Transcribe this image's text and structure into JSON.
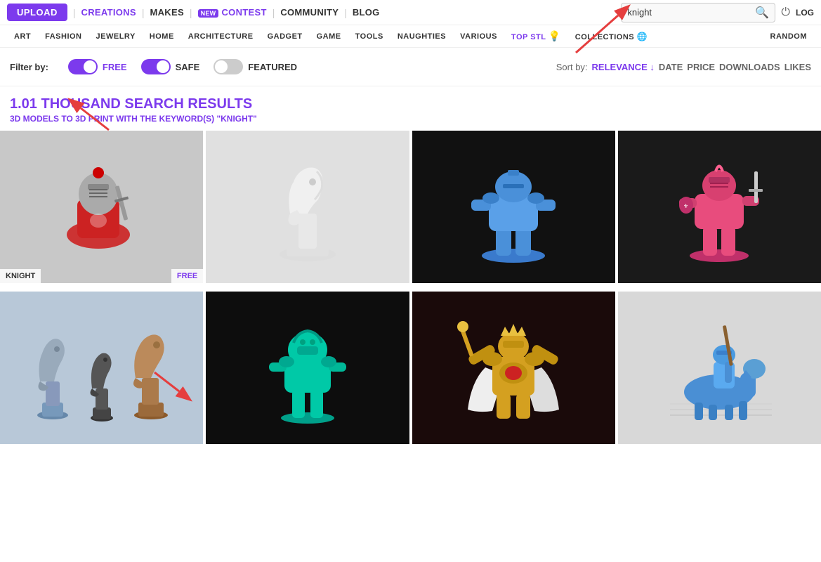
{
  "topnav": {
    "upload_label": "UPLOAD",
    "creations_label": "CREATIONS",
    "makes_label": "MAKES",
    "new_badge": "NEW",
    "contest_label": "CONTEST",
    "community_label": "COMMUNITY",
    "blog_label": "BLOG",
    "search_value": "knight",
    "log_label": "LOG"
  },
  "secondnav": {
    "categories": [
      {
        "label": "ART",
        "active": false
      },
      {
        "label": "FASHION",
        "active": false
      },
      {
        "label": "JEWELRY",
        "active": false
      },
      {
        "label": "HOME",
        "active": false
      },
      {
        "label": "ARCHITECTURE",
        "active": false
      },
      {
        "label": "GADGET",
        "active": false
      },
      {
        "label": "GAME",
        "active": false
      },
      {
        "label": "TOOLS",
        "active": false
      },
      {
        "label": "NAUGHTIES",
        "active": false
      },
      {
        "label": "VARIOUS",
        "active": false
      },
      {
        "label": "TOP STL",
        "active": true
      },
      {
        "label": "COLLECTIONS",
        "active": false
      },
      {
        "label": "RANDOM",
        "active": false
      }
    ]
  },
  "filters": {
    "filter_by_label": "Filter by:",
    "free_label": "FREE",
    "safe_label": "SAFE",
    "featured_label": "FEATURED",
    "free_on": true,
    "safe_on": true,
    "featured_on": false
  },
  "sort": {
    "sort_by_label": "Sort by:",
    "options": [
      {
        "label": "RELEVANCE ↓",
        "active": true
      },
      {
        "label": "DATE",
        "active": false
      },
      {
        "label": "PRICE",
        "active": false
      },
      {
        "label": "DOWNLOADS",
        "active": false
      },
      {
        "label": "LIKES",
        "active": false
      }
    ]
  },
  "results": {
    "count": "1.01 THOUSAND SEARCH RESULTS",
    "subtitle": "3D MODELS TO 3D PRINT WITH THE KEYWORD(S) \"KNIGHT\""
  },
  "grid": {
    "items": [
      {
        "id": 1,
        "label": "KNIGHT",
        "badge": "FREE",
        "bg": "#c8c8c8",
        "figure_color": "#888"
      },
      {
        "id": 2,
        "label": "",
        "badge": "",
        "bg": "#e0e0e0",
        "figure_color": "#f0f0f0"
      },
      {
        "id": 3,
        "label": "",
        "badge": "",
        "bg": "#111",
        "figure_color": "#4a90d9"
      },
      {
        "id": 4,
        "label": "",
        "badge": "",
        "bg": "#1a1a1a",
        "figure_color": "#e84c7d"
      },
      {
        "id": 5,
        "label": "",
        "badge": "",
        "bg": "#c0c8d8",
        "figure_color": "#7a9bcc"
      },
      {
        "id": 6,
        "label": "",
        "badge": "",
        "bg": "#0d0d0d",
        "figure_color": "#00c9a7"
      },
      {
        "id": 7,
        "label": "",
        "badge": "",
        "bg": "#1a0a0a",
        "figure_color": "#d4a020"
      },
      {
        "id": 8,
        "label": "",
        "badge": "",
        "bg": "#d8d8d8",
        "figure_color": "#4a8fd4"
      }
    ]
  },
  "colors": {
    "purple": "#7c3aed",
    "red": "#e53e3e"
  }
}
